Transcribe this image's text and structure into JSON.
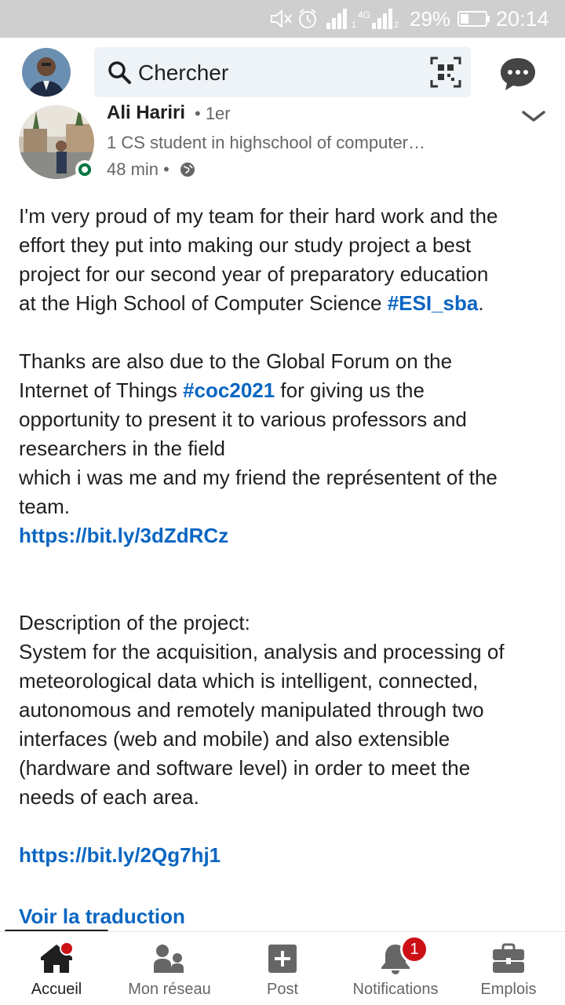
{
  "status_bar": {
    "battery_percent": "29%",
    "time": "20:14",
    "network_label": "4G",
    "sim1": "1",
    "sim2": "2",
    "icons": [
      "mute-icon",
      "alarm-icon",
      "signal-icon",
      "battery-icon"
    ]
  },
  "top_bar": {
    "search_placeholder": "Chercher",
    "icons": [
      "search-icon",
      "qr-code-icon",
      "messaging-icon"
    ]
  },
  "post": {
    "author_name": "Ali Hariri",
    "degree": "• 1er",
    "headline": "1 CS student in highschool of computer…",
    "time": "48 min •",
    "body_lines": [
      {
        "type": "text",
        "text": "I'm very proud of my team for their hard work and the"
      },
      {
        "type": "text",
        "text": "effort they put into making our study project a best"
      },
      {
        "type": "text",
        "text": "project for our second year of preparatory education"
      },
      {
        "type": "mixed",
        "before": "at the High School of Computer Science ",
        "tag": "#ESI_sba",
        "after": "."
      },
      {
        "type": "blank"
      },
      {
        "type": "text",
        "text": "Thanks are also due to the Global Forum on the"
      },
      {
        "type": "mixed",
        "before": "Internet of Things ",
        "tag": "#coc2021",
        "after": " for giving us the"
      },
      {
        "type": "text",
        "text": "opportunity to present it to various professors and"
      },
      {
        "type": "text",
        "text": "researchers in the field"
      },
      {
        "type": "text",
        "text": "which i was me and my friend the représentent of the"
      },
      {
        "type": "text",
        "text": "team."
      },
      {
        "type": "link",
        "text": "https://bit.ly/3dZdRCz"
      },
      {
        "type": "blank"
      },
      {
        "type": "blank"
      },
      {
        "type": "text",
        "text": "Description of the project:"
      },
      {
        "type": "text",
        "text": "System for the acquisition, analysis and processing of"
      },
      {
        "type": "text",
        "text": "meteorological data which is intelligent, connected,"
      },
      {
        "type": "text",
        "text": "autonomous and remotely manipulated through two"
      },
      {
        "type": "text",
        "text": "interfaces (web and mobile) and also extensible"
      },
      {
        "type": "text",
        "text": "(hardware and software level) in order to meet the"
      },
      {
        "type": "text",
        "text": "needs of  each area."
      },
      {
        "type": "blank"
      },
      {
        "type": "link",
        "text": "https://bit.ly/2Qg7hj1"
      }
    ],
    "translate_label": "Voir la traduction"
  },
  "bottom_nav": {
    "items": [
      {
        "label": "Accueil",
        "icon": "home-icon"
      },
      {
        "label": "Mon réseau",
        "icon": "network-icon"
      },
      {
        "label": "Post",
        "icon": "post-icon"
      },
      {
        "label": "Notifications",
        "icon": "bell-icon"
      },
      {
        "label": "Emplois",
        "icon": "briefcase-icon"
      }
    ],
    "notifications_badge": "1"
  },
  "colors": {
    "accent": "#0a66c2",
    "badge": "#cc1016",
    "online": "#057642",
    "status_bar": "#cfcfcf",
    "search_bg": "#eef3f8"
  }
}
